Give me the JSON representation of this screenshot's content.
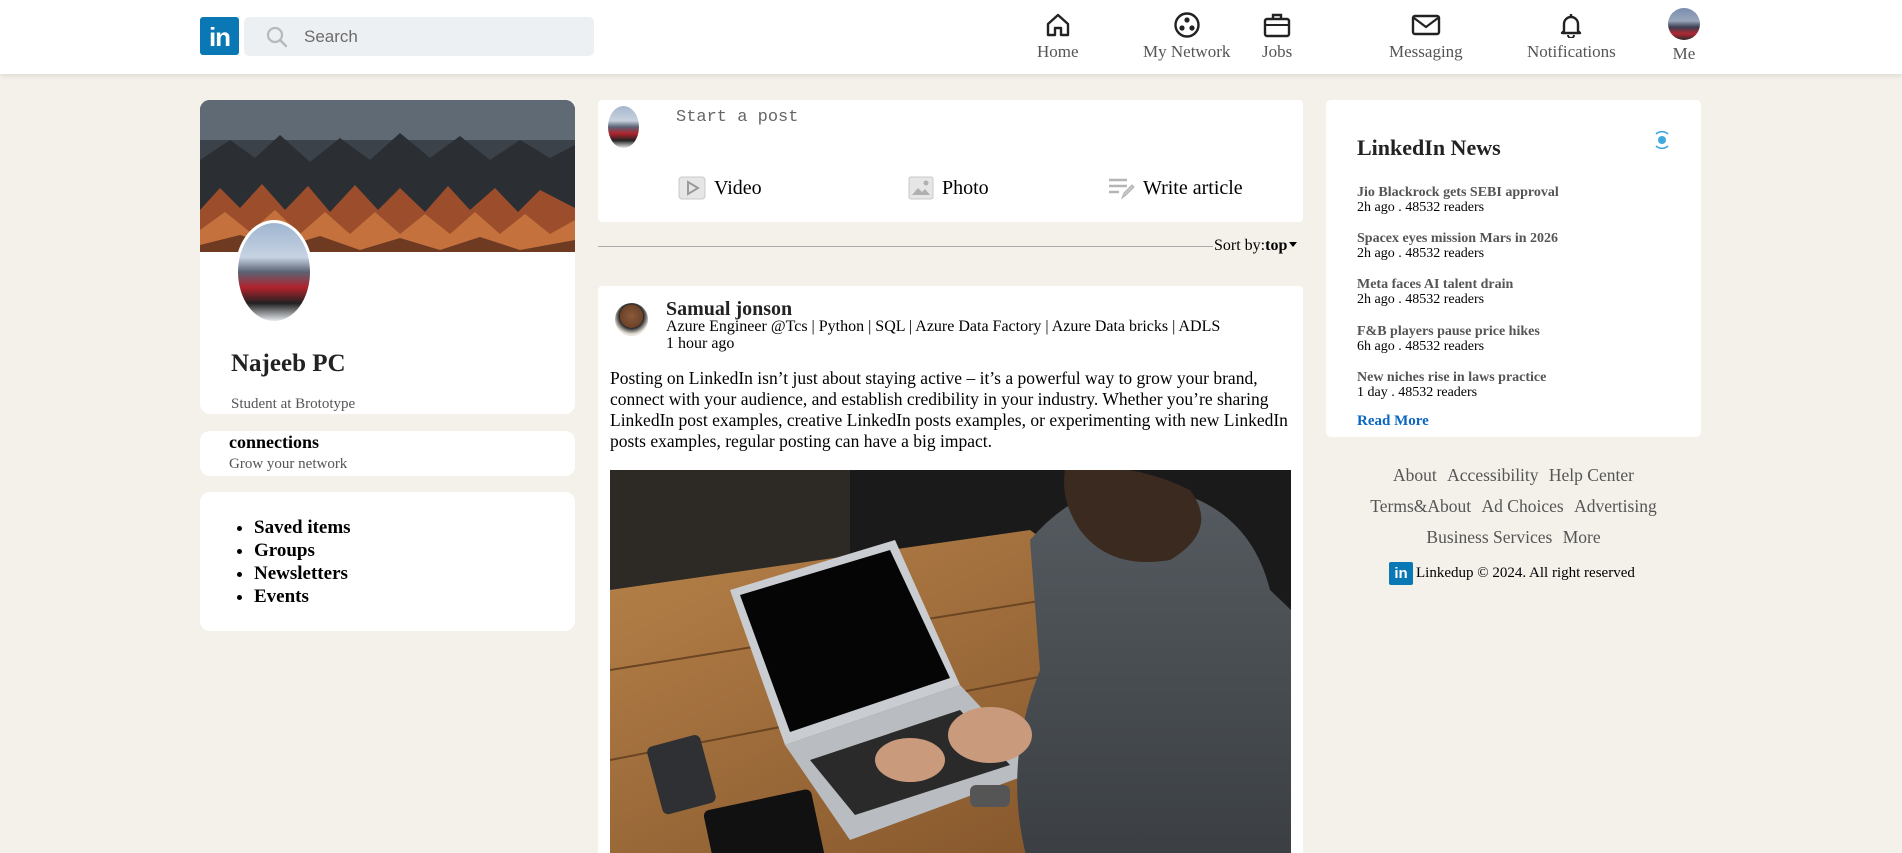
{
  "brand": {
    "logo_text": "in",
    "accent": "#0a78b5"
  },
  "search": {
    "placeholder": "Search"
  },
  "nav": [
    {
      "label": "Home",
      "icon": "home-icon"
    },
    {
      "label": "My Network",
      "icon": "network-icon"
    },
    {
      "label": "Jobs",
      "icon": "briefcase-icon"
    },
    {
      "label": "Messaging",
      "icon": "envelope-icon"
    },
    {
      "label": "Notifications",
      "icon": "bell-icon"
    },
    {
      "label": "Me",
      "icon": "avatar"
    }
  ],
  "profile": {
    "name": "Najeeb PC",
    "subtitle": "Student at Brototype",
    "connections_title": "connections",
    "connections_sub": "Grow your network",
    "links": [
      "Saved items",
      "Groups",
      "Newsletters",
      "Events"
    ]
  },
  "composer": {
    "placeholder": "Start a post",
    "actions": [
      {
        "label": "Video",
        "icon": "video-icon"
      },
      {
        "label": "Photo",
        "icon": "photo-icon"
      },
      {
        "label": "Write article",
        "icon": "article-icon"
      }
    ]
  },
  "sort": {
    "label": "Sort by:",
    "value": "top"
  },
  "post": {
    "author": "Samual jonson",
    "headline": "Azure Engineer @Tcs | Python | SQL | Azure Data Factory | Azure Data bricks | ADLS",
    "time": "1 hour ago",
    "text": "Posting on LinkedIn isn’t just about staying active – it’s a powerful way to grow your brand, connect with your audience, and establish credibility in your industry. Whether you’re sharing LinkedIn post examples, creative LinkedIn posts examples, or experimenting with new LinkedIn posts examples, regular posting can have a big impact."
  },
  "news": {
    "title": "LinkedIn News",
    "items": [
      {
        "headline": "Jio Blackrock gets SEBI approval",
        "meta": "2h ago . 48532 readers"
      },
      {
        "headline": "Spacex eyes mission Mars in 2026",
        "meta": "2h ago . 48532 readers"
      },
      {
        "headline": "Meta faces AI talent drain",
        "meta": "2h ago . 48532 readers"
      },
      {
        "headline": "F&B players pause price hikes",
        "meta": "6h ago . 48532 readers"
      },
      {
        "headline": "New niches rise in laws practice",
        "meta": "1 day . 48532 readers"
      }
    ],
    "read_more": "Read More"
  },
  "footer": {
    "links": [
      "About",
      "Accessibility",
      "Help Center",
      "Terms&About",
      "Ad Choices",
      "Advertising",
      "Business Services",
      "More"
    ],
    "copyright": "Linkedup © 2024. All right reserved"
  }
}
